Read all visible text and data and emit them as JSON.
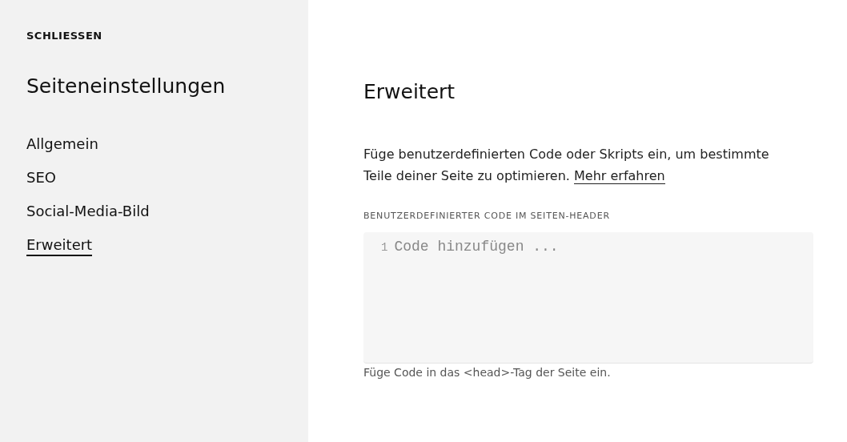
{
  "sidebar": {
    "close_label": "SCHLIESSEN",
    "title": "Seiteneinstellungen",
    "items": [
      {
        "label": "Allgemein",
        "selected": false
      },
      {
        "label": "SEO",
        "selected": false
      },
      {
        "label": "Social-Media-Bild",
        "selected": false
      },
      {
        "label": "Erweitert",
        "selected": true
      }
    ]
  },
  "content": {
    "title": "Erweitert",
    "description": "Füge benutzerdefinierten Code oder Skripts ein, um bestimmte Teile deiner Seite zu optimieren.",
    "link": "Mehr erfahren",
    "field_label": "BENUTZERDEFINIERTER CODE IM SEITEN-HEADER",
    "line_number": "1",
    "placeholder": "Code hinzufügen ...",
    "help": "Füge Code in das <head>-Tag der Seite ein."
  }
}
